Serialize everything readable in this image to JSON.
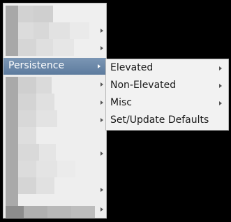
{
  "context_menu": {
    "selected_item": {
      "label": "Persistence",
      "has_submenu": true
    }
  },
  "submenu": {
    "items": [
      {
        "label": "Elevated",
        "has_submenu": true
      },
      {
        "label": "Non-Elevated",
        "has_submenu": true
      },
      {
        "label": "Misc",
        "has_submenu": true
      },
      {
        "label": "Set/Update Defaults",
        "has_submenu": false
      }
    ]
  },
  "colors": {
    "selection_top": "#7b96b4",
    "selection_bottom": "#5d7b9e",
    "menu_background": "#f2f2f2",
    "menu_border": "#b9b9b9",
    "page_background": "#000000"
  }
}
